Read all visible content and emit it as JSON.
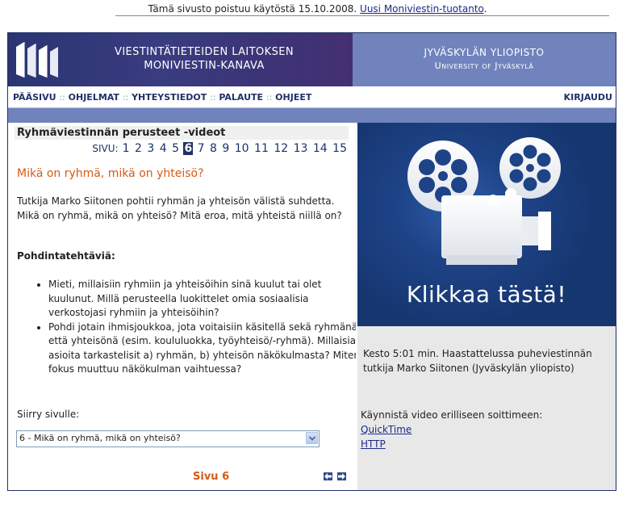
{
  "notice": {
    "text": "Tämä sivusto poistuu käytöstä 15.10.2008. ",
    "link": "Uusi Moniviestin-tuotanto",
    "suffix": "."
  },
  "banner": {
    "title_line1": "VIESTINTÄTIETEIDEN LAITOKSEN",
    "title_line2": "MONIVIESTIN-KANAVA",
    "university_fi": "JYVÄSKYLÄN YLIOPISTO",
    "university_en": "University of Jyväskylä"
  },
  "nav": {
    "items": [
      "PÄÄSIVU",
      "OHJELMAT",
      "YHTEYSTIEDOT",
      "PALAUTE",
      "OHJEET"
    ],
    "separator": "::",
    "login": "KIRJAUDU"
  },
  "content": {
    "video_series_title": "Ryhmäviestinnän perusteet -videot",
    "pager_label": "SIVU:",
    "pages": [
      "1",
      "2",
      "3",
      "4",
      "5",
      "6",
      "7",
      "8",
      "9",
      "10",
      "11",
      "12",
      "13",
      "14",
      "15"
    ],
    "current_page": "6",
    "heading": "Mikä on ryhmä, mikä on yhteisö?",
    "intro": "Tutkija Marko Siitonen pohtii ryhmän ja yhteisön välistä suhdetta. Mikä on ryhmä, mikä on yhteisö? Mitä eroa, mitä yhteistä niillä on?",
    "tasks_title": "Pohdintatehtäviä:",
    "tasks": [
      "Mieti, millaisiin ryhmiin ja yhteisöihin sinä kuulut tai olet kuulunut. Millä perusteella luokittelet omia sosiaalisia verkostojasi ryhmiin ja yhteisöihin?",
      "Pohdi jotain ihmisjoukkoa, jota voitaisiin käsitellä sekä ryhmänä että yhteisönä (esim. koululuokka, työyhteisö/-ryhmä). Millaisia asioita tarkastelisit a) ryhmän, b) yhteisön näkökulmasta? Miten fokus muuttuu näkökulman vaihtuessa?"
    ],
    "goto_label": "Siirry sivulle:",
    "select_value": "6 - Mikä on ryhmä, mikä on yhteisö?",
    "page_indicator": "Sivu 6"
  },
  "video": {
    "click_text": "Klikkaa tästä!",
    "duration_text": "Kesto 5:01 min. Haastattelussa puheviestinnän tutkija Marko Siitonen (Jyväskylän yliopisto)",
    "launch_text": "Käynnistä video erilliseen soittimeen:",
    "link_quicktime": "QuickTime",
    "link_http": "HTTP"
  },
  "colors": {
    "banner_dark": "#2a3572",
    "banner_light": "#7183bd",
    "accent_orange": "#d65a17",
    "nav_text": "#1f3168",
    "video_blue": "#1e4387"
  },
  "icons": [
    "logo-icon",
    "projector-icon",
    "dropdown-arrow-icon",
    "arrow-left-icon",
    "arrow-right-icon"
  ]
}
